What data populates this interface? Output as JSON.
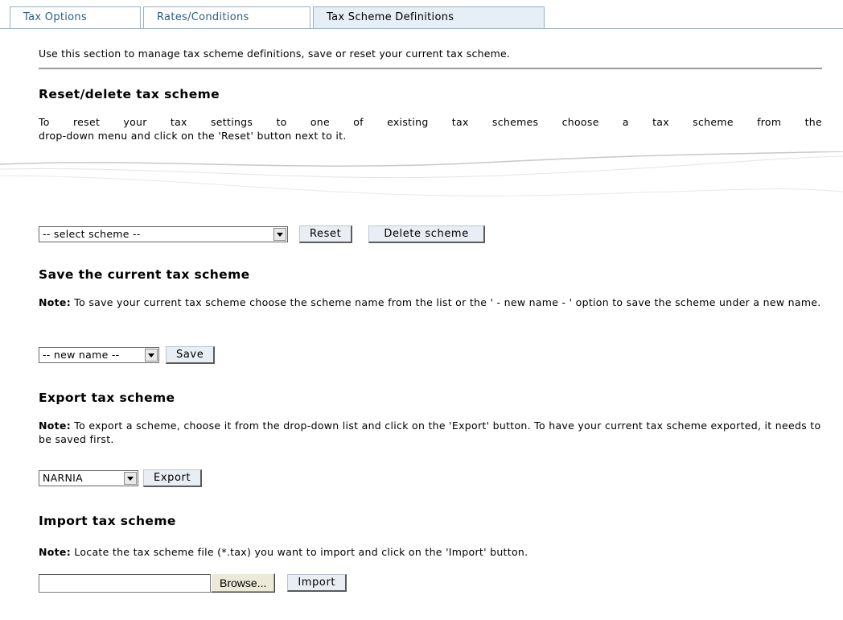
{
  "tabs": [
    {
      "label": "Tax Options"
    },
    {
      "label": "Rates/Conditions"
    },
    {
      "label": "Tax Scheme Definitions"
    }
  ],
  "intro": "Use this section to manage tax scheme definitions, save or reset your current tax scheme.",
  "reset_section": {
    "title": "Reset/delete tax scheme",
    "text_line1": "To reset your tax settings to one of existing tax schemes choose a tax scheme from the",
    "text_line2": "drop-down menu and click on the 'Reset' button next to it.",
    "select_value": "-- select scheme --",
    "reset_label": "Reset",
    "delete_label": "Delete scheme"
  },
  "save_section": {
    "title": "Save the current tax scheme",
    "note_label": "Note:",
    "note_text": " To save your current tax scheme choose the scheme name from the list or the ' - new name - ' option to save the scheme under a new name.",
    "select_value": "-- new name --",
    "save_label": "Save"
  },
  "export_section": {
    "title": "Export tax scheme",
    "note_label": "Note:",
    "note_text": " To export a scheme, choose it from the drop-down list and click on the 'Export' button. To have your current tax scheme exported, it needs to be saved first.",
    "select_value": "NARNIA",
    "export_label": "Export"
  },
  "import_section": {
    "title": "Import tax scheme",
    "note_label": "Note:",
    "note_text": " Locate the tax scheme file (*.tax) you want to import and click on the 'Import' button.",
    "file_value": "",
    "browse_label": "Browse...",
    "import_label": "Import"
  },
  "colors": {
    "tab_border": "#9ab0c4",
    "tab_text": "#2a5d8a",
    "button_bg": "#e8eef4"
  }
}
